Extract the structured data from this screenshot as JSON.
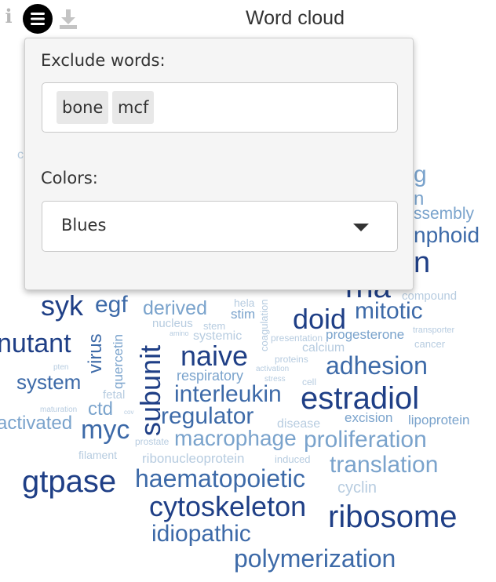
{
  "title": "Word cloud",
  "panel": {
    "exclude_label": "Exclude words:",
    "exclude_tags": [
      "bone",
      "mcf"
    ],
    "colors_label": "Colors:",
    "colors_value": "Blues"
  },
  "cloud_words": [
    "syk",
    "egf",
    "derived",
    "hela",
    "stim",
    "doid",
    "mitotic",
    "compound",
    "nutant",
    "virus",
    "quercetin",
    "nucleus",
    "stem",
    "amino",
    "systemic",
    "coagulation",
    "presentation",
    "progesterone",
    "transporter",
    "calcium",
    "cancer",
    "system",
    "subunit",
    "naive",
    "respiratory",
    "proteins",
    "activation",
    "adhesion",
    "pten",
    "fetal",
    "interleukin",
    "stress",
    "cell",
    "estradiol",
    "activated",
    "ctd",
    "maturation",
    "cov",
    "regulator",
    "excision",
    "lipoprotein",
    "myc",
    "disease",
    "macrophage",
    "prostate",
    "proliferation",
    "filament",
    "ribonucleoprotein",
    "induced",
    "translation",
    "gtpase",
    "haematopoietic",
    "cyclin",
    "cytoskeleton",
    "ribosome",
    "idiopathic",
    "polymerization",
    "g",
    "n",
    "ssembly",
    "nphoid",
    "n",
    "rna"
  ],
  "colors": {
    "dark": "#1f3f86",
    "mid": "#3d6aa8",
    "light": "#7aa3cc",
    "pale": "#b7cce0"
  }
}
